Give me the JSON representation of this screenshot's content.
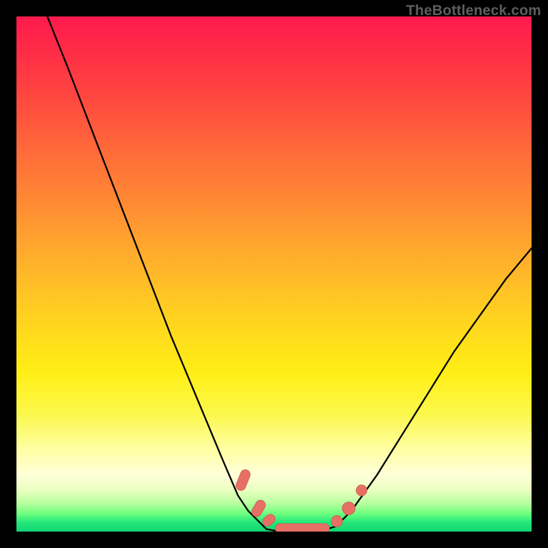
{
  "watermark": "TheBottleneck.com",
  "colors": {
    "frame": "#000000",
    "curve_stroke": "#000000",
    "marker_fill": "#e77065",
    "marker_stroke": "#c9584e"
  },
  "chart_data": {
    "type": "line",
    "title": "",
    "xlabel": "",
    "ylabel": "",
    "xlim": [
      0,
      100
    ],
    "ylim": [
      0,
      100
    ],
    "grid": false,
    "legend": false,
    "series": [
      {
        "name": "left-branch",
        "x": [
          6,
          10,
          15,
          20,
          25,
          30,
          35,
          40,
          43,
          45,
          47,
          48.5
        ],
        "y": [
          100,
          90,
          77,
          64,
          51,
          38,
          26,
          14,
          7,
          4,
          2,
          0.5
        ]
      },
      {
        "name": "valley",
        "x": [
          48.5,
          50,
          52,
          54,
          56,
          58,
          60,
          62
        ],
        "y": [
          0.5,
          0.2,
          0.1,
          0.1,
          0.1,
          0.2,
          0.4,
          1
        ]
      },
      {
        "name": "right-branch",
        "x": [
          62,
          65,
          70,
          75,
          80,
          85,
          90,
          95,
          100
        ],
        "y": [
          1,
          4,
          11,
          19,
          27,
          35,
          42,
          49,
          55
        ]
      }
    ],
    "markers": [
      {
        "name": "left-cluster",
        "shape": "pill",
        "points": [
          {
            "x": 44.0,
            "y": 10.0,
            "angle": -68,
            "len": 4.2,
            "width": 1.9
          },
          {
            "x": 47.0,
            "y": 4.5,
            "angle": -60,
            "len": 3.4,
            "width": 1.9
          },
          {
            "x": 49.0,
            "y": 2.2,
            "angle": -40,
            "len": 2.6,
            "width": 1.8
          }
        ]
      },
      {
        "name": "bottom-bar",
        "shape": "pill",
        "points": [
          {
            "x": 55.5,
            "y": 0.6,
            "angle": 0,
            "len": 10.5,
            "width": 1.9
          }
        ]
      },
      {
        "name": "right-cluster",
        "shape": "dot",
        "points": [
          {
            "x": 62.2,
            "y": 2.0,
            "r": 1.1
          },
          {
            "x": 64.5,
            "y": 4.5,
            "r": 1.25
          },
          {
            "x": 67.0,
            "y": 8.0,
            "r": 1.05
          }
        ]
      }
    ]
  }
}
